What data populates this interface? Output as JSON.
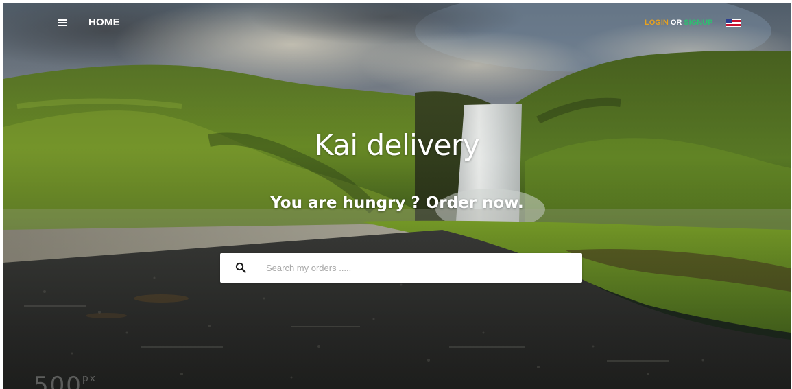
{
  "nav": {
    "home_label": "HOME",
    "login_label": "LOGIN",
    "or_label": "OR",
    "signup_label": "SIGNUP",
    "menu_icon": "hamburger-menu-icon",
    "flag_icon": "us-flag-icon"
  },
  "hero": {
    "title": "Kai delivery",
    "subtitle": "You are hungry ? Order now."
  },
  "search": {
    "placeholder": "Search my orders .....",
    "value": "",
    "icon": "search-icon"
  },
  "watermark": {
    "text": "500",
    "suffix": "px"
  },
  "colors": {
    "login": "#e8a21e",
    "signup": "#2fbf71",
    "text": "#ffffff"
  }
}
